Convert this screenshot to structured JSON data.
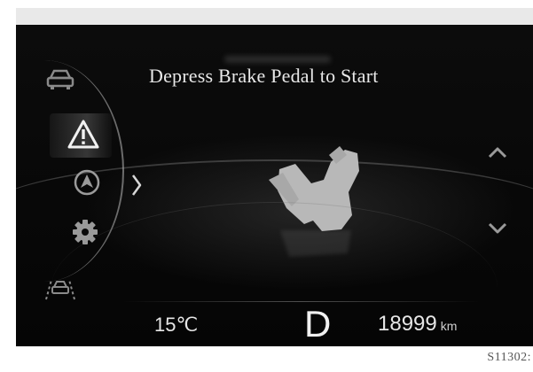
{
  "cluster": {
    "message": "Depress Brake Pedal to Start",
    "temperature": "15",
    "temperature_unit": "℃",
    "gear": "D",
    "odometer": "18999",
    "odometer_unit": "km"
  },
  "sidebar": {
    "items": [
      {
        "icon": "car-icon"
      },
      {
        "icon": "warning-icon",
        "selected": true
      },
      {
        "icon": "navigation-icon"
      },
      {
        "icon": "settings-icon"
      },
      {
        "icon": "driver-assist-icon"
      }
    ]
  },
  "image_code": "S11302:",
  "colors": {
    "background": "#0a0a0a",
    "text": "#e8e8e8",
    "icon": "#bdbdbd",
    "vehicle": "#b8b8b8"
  }
}
